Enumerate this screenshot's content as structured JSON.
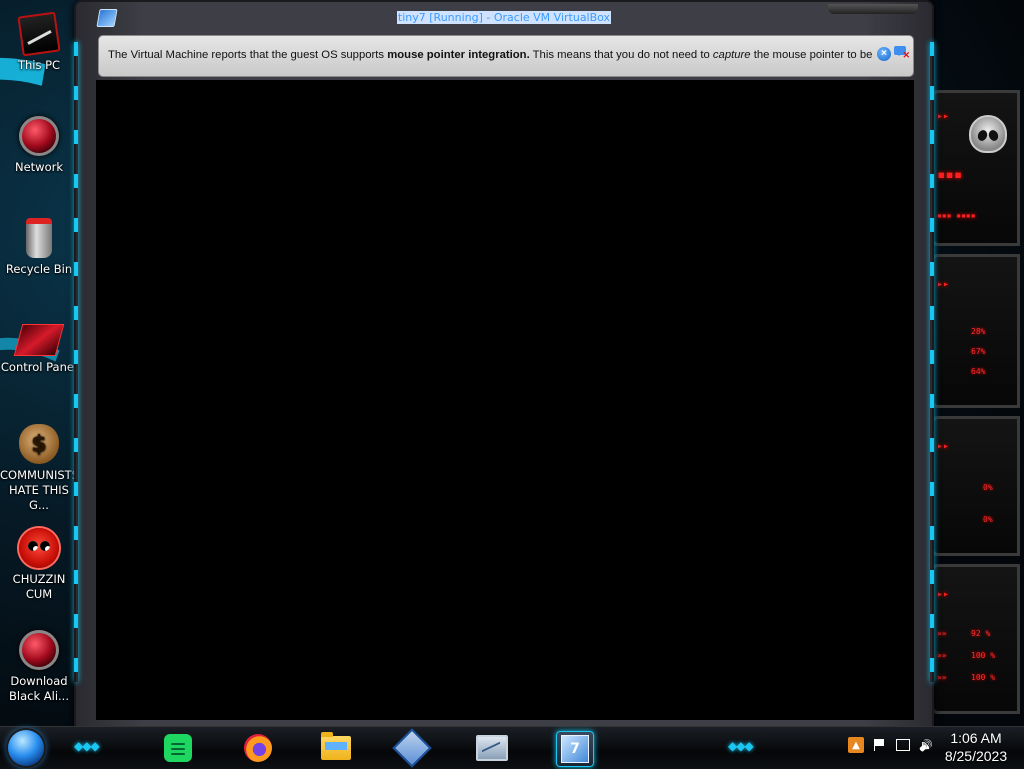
{
  "desktop": {
    "icons": [
      {
        "label": "This PC",
        "icon": "computer-icon"
      },
      {
        "label": "Network",
        "icon": "network-icon"
      },
      {
        "label": "Recycle Bin",
        "icon": "recycle-bin-icon"
      },
      {
        "label": "Control Panel",
        "icon": "control-panel-icon"
      },
      {
        "label": "COMMUNISTS HATE THIS G...",
        "icon": "money-bag-icon"
      },
      {
        "label": "CHUZZIN CUM",
        "icon": "fuzzy-creature-icon"
      },
      {
        "label": "Download Black Ali...",
        "icon": "alienware-orb-icon"
      }
    ]
  },
  "gadgets": {
    "cpu_percents": [
      "28%",
      "67%",
      "64%"
    ],
    "disk_percents": [
      "0%",
      "0%"
    ],
    "net_percents": [
      "92 %",
      "100 %",
      "100 %"
    ]
  },
  "window": {
    "title": "tiny7 [Running] - Oracle VM VirtualBox",
    "notice": {
      "text_before": "The Virtual Machine reports that the guest OS supports ",
      "bold": "mouse pointer integration.",
      "text_middle": " This means that you do not need to ",
      "italic": "capture",
      "text_after": " the mouse pointer to be",
      "close_icon": "close-circle-icon",
      "dismiss_icon": "message-dismiss-icon"
    }
  },
  "taskbar": {
    "apps": [
      {
        "name": "Spotify",
        "icon": "spotify-icon",
        "active": false
      },
      {
        "name": "Firefox",
        "icon": "firefox-icon",
        "active": false
      },
      {
        "name": "File Explorer",
        "icon": "folder-icon",
        "active": false
      },
      {
        "name": "VirtualBox",
        "icon": "virtualbox-icon",
        "active": false
      },
      {
        "name": "Resource Monitor",
        "icon": "monitor-icon",
        "active": false
      },
      {
        "name": "tiny7",
        "icon": "windows7-icon",
        "active": true
      }
    ],
    "time": "1:06 AM",
    "date": "8/25/2023"
  },
  "colors": {
    "accent": "#19c7f2",
    "alert_red": "#ff1f1f",
    "notice_bg": "#d8d8d8"
  }
}
